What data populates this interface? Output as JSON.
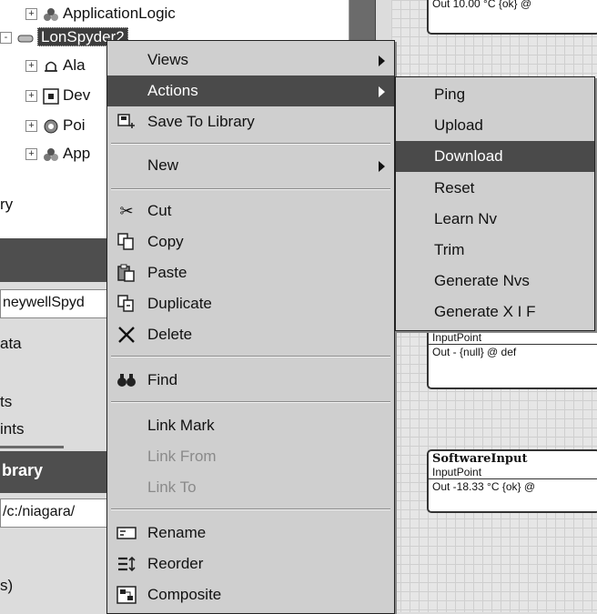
{
  "tree": {
    "items": [
      {
        "label": "ApplicationLogic",
        "expander": "+",
        "icon": "application-logic-icon"
      },
      {
        "label": "LonSpyder2",
        "expander": "-",
        "icon": "device-icon"
      },
      {
        "label": "Ala",
        "expander": "+",
        "icon": "alarm-bell-icon"
      },
      {
        "label": "Dev",
        "expander": "+",
        "icon": "device-grid-icon"
      },
      {
        "label": "Poi",
        "expander": "+",
        "icon": "points-icon"
      },
      {
        "label": "App",
        "expander": "+",
        "icon": "application-icon"
      }
    ]
  },
  "left_panel": {
    "rary": "ry",
    "dark_band_1": "",
    "neywellspyd": "neywellSpyd",
    "data": "ata",
    "ts": "ts",
    "ints": "ints",
    "library_header": "brary",
    "path": "/c:/niagara/",
    "s": "s)"
  },
  "context_menu": {
    "items": [
      {
        "label": "Views",
        "submenu": true
      },
      {
        "label": "Actions",
        "submenu": true,
        "highlighted": true
      },
      {
        "label": "Save To Library",
        "icon": "save-to-library-icon"
      },
      {
        "label": "New",
        "submenu": true
      },
      {
        "label": "Cut",
        "icon": "scissors-icon"
      },
      {
        "label": "Copy",
        "icon": "copy-icon"
      },
      {
        "label": "Paste",
        "icon": "paste-icon"
      },
      {
        "label": "Duplicate",
        "icon": "duplicate-icon"
      },
      {
        "label": "Delete",
        "icon": "delete-x-icon"
      },
      {
        "label": "Find",
        "icon": "binoculars-icon"
      },
      {
        "label": "Link Mark"
      },
      {
        "label": "Link From",
        "disabled": true
      },
      {
        "label": "Link To",
        "disabled": true
      },
      {
        "label": "Rename",
        "icon": "rename-icon"
      },
      {
        "label": "Reorder",
        "icon": "reorder-icon"
      },
      {
        "label": "Composite",
        "icon": "composite-icon"
      }
    ]
  },
  "actions_submenu": {
    "items": [
      {
        "label": "Ping"
      },
      {
        "label": "Upload"
      },
      {
        "label": "Download",
        "highlighted": true
      },
      {
        "label": "Reset"
      },
      {
        "label": "Learn Nv"
      },
      {
        "label": "Trim"
      },
      {
        "label": "Generate Nvs"
      },
      {
        "label": "Generate X I F"
      }
    ]
  },
  "property_cards": {
    "card_top": {
      "out": "Out  10.00 °C {ok} @"
    },
    "card_mid": {
      "subtitle": "InputPoint",
      "out": "Out     - {null} @ def"
    },
    "card_bottom": {
      "title": "SoftwareInput",
      "subtitle": "InputPoint",
      "out": "Out  -18.33 °C {ok} @"
    }
  }
}
